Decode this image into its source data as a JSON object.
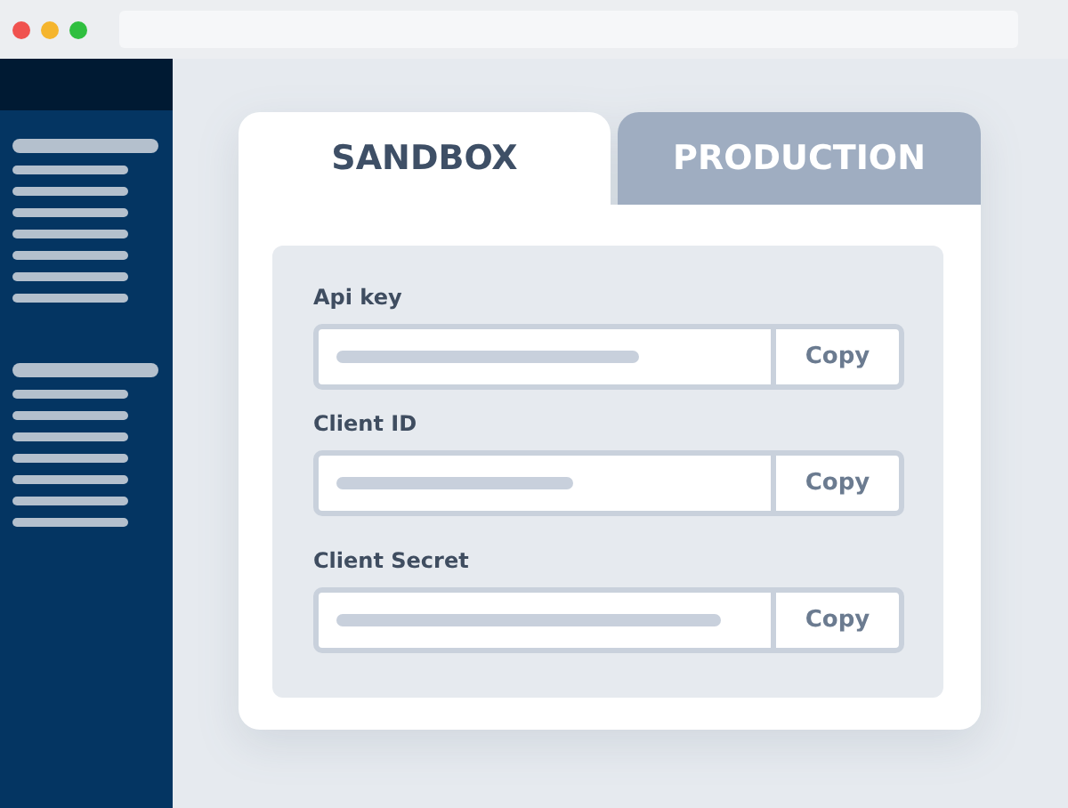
{
  "tabs": [
    {
      "label": "SANDBOX",
      "selected": true
    },
    {
      "label": "PRODUCTION",
      "selected": false
    }
  ],
  "fields": [
    {
      "label": "Api key",
      "button": "Copy"
    },
    {
      "label": "Client ID",
      "button": "Copy"
    },
    {
      "label": "Client Secret",
      "button": "Copy"
    }
  ]
}
